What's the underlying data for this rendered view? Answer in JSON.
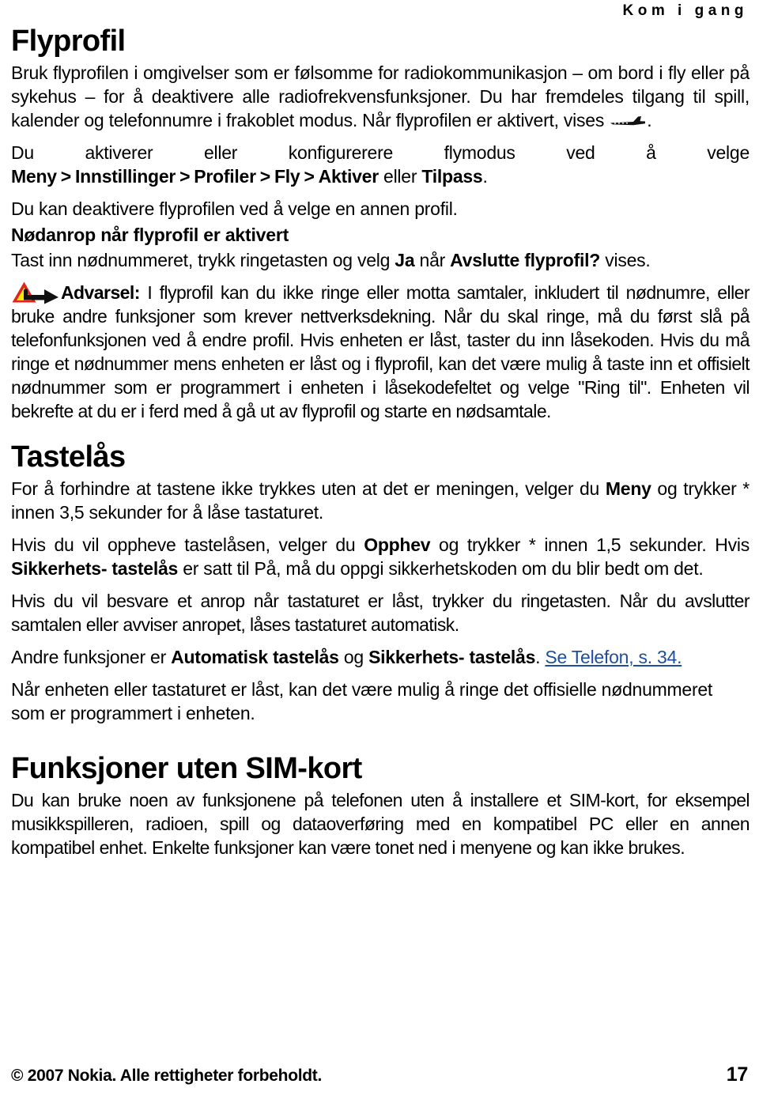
{
  "header": {
    "running_head": "Kom i gang"
  },
  "sections": [
    {
      "id": "flyprofil",
      "title": "Flyprofil",
      "paragraphs": [
        {
          "id": "intro",
          "runs": [
            {
              "t": "Bruk flyprofilen i omgivelser som er følsomme for radiokommunikasjon – om bord i fly eller på sykehus – for å deaktivere alle radiofrekvensfunksjoner. Du har fremdeles tilgang til spill, kalender og telefonnumre i frakoblet modus. Når flyprofilen er aktivert, vises ",
              "style": "normal"
            },
            {
              "t": "airplane-icon",
              "style": "icon"
            },
            {
              "t": ".",
              "style": "normal"
            }
          ]
        },
        {
          "id": "activate",
          "runs": [
            {
              "t": "Du aktiverer eller konfigurerere flymodus ved å velge ",
              "style": "normal"
            },
            {
              "t": "Meny",
              "style": "bold"
            },
            {
              "t": ">",
              "style": "gt"
            },
            {
              "t": "Innstillinger",
              "style": "bold"
            },
            {
              "t": ">",
              "style": "gt"
            },
            {
              "t": "Profiler",
              "style": "bold"
            },
            {
              "t": ">",
              "style": "gt"
            },
            {
              "t": "Fly",
              "style": "bold"
            },
            {
              "t": ">",
              "style": "gt"
            },
            {
              "t": "Aktiver",
              "style": "bold"
            },
            {
              "t": " eller ",
              "style": "normal"
            },
            {
              "t": "Tilpass",
              "style": "bold"
            },
            {
              "t": ".",
              "style": "normal"
            }
          ]
        },
        {
          "id": "deactivate",
          "runs": [
            {
              "t": "Du kan deaktivere flyprofilen ved å velge en annen profil.",
              "style": "normal"
            }
          ]
        }
      ],
      "subsections": [
        {
          "id": "nodanrop",
          "heading": "Nødanrop når flyprofil er aktivert",
          "paragraphs": [
            {
              "id": "nodanrop-p1",
              "runs": [
                {
                  "t": "Tast inn nødnummeret, trykk ringetasten og velg ",
                  "style": "normal"
                },
                {
                  "t": "Ja",
                  "style": "bold"
                },
                {
                  "t": " når ",
                  "style": "normal"
                },
                {
                  "t": "Avslutte flyprofil?",
                  "style": "bold"
                },
                {
                  "t": " vises.",
                  "style": "normal"
                }
              ]
            }
          ]
        }
      ],
      "warning": {
        "icon": "warning-triangle-arrow-icon",
        "label": "Advarsel:",
        "text": " I flyprofil kan du ikke ringe eller motta samtaler, inkludert til nødnumre, eller bruke andre funksjoner som krever nettverksdekning. Når du skal ringe, må du først slå på telefonfunksjonen ved å endre profil. Hvis enheten er låst, taster du inn låsekoden. Hvis du må ringe et nødnummer mens enheten er låst og i flyprofil, kan det være mulig å taste inn et offisielt nødnummer som er programmert i enheten i låsekodefeltet og velge \"Ring til\". Enheten vil bekrefte at du er i ferd med å gå ut av flyprofil og starte en nødsamtale."
      }
    },
    {
      "id": "tastelas",
      "title": "Tastelås",
      "paragraphs": [
        {
          "id": "tastelas-p1",
          "runs": [
            {
              "t": "For å forhindre at tastene ikke trykkes uten at det er meningen, velger du ",
              "style": "normal"
            },
            {
              "t": "Meny",
              "style": "bold"
            },
            {
              "t": " og trykker * innen 3,5 sekunder for å låse tastaturet.",
              "style": "normal"
            }
          ]
        },
        {
          "id": "tastelas-p2",
          "runs": [
            {
              "t": "Hvis du vil oppheve tastelåsen, velger du ",
              "style": "normal"
            },
            {
              "t": "Opphev",
              "style": "bold"
            },
            {
              "t": " og trykker * innen 1,5 sekunder. Hvis ",
              "style": "normal"
            },
            {
              "t": "Sikkerhets- tastelås",
              "style": "bold"
            },
            {
              "t": " er satt til På, må du oppgi sikkerhetskoden om du blir bedt om det.",
              "style": "normal"
            }
          ]
        },
        {
          "id": "tastelas-p3",
          "runs": [
            {
              "t": "Hvis du vil besvare et anrop når tastaturet er låst, trykker du ringetasten. Når du avslutter samtalen eller avviser anropet, låses tastaturet automatisk.",
              "style": "normal"
            }
          ]
        },
        {
          "id": "tastelas-p4",
          "runs": [
            {
              "t": "Andre funksjoner er ",
              "style": "normal"
            },
            {
              "t": "Automatisk tastelås",
              "style": "bold"
            },
            {
              "t": " og ",
              "style": "normal"
            },
            {
              "t": "Sikkerhets- tastelås",
              "style": "bold"
            },
            {
              "t": ". ",
              "style": "normal"
            },
            {
              "t": "Se Telefon, s. 34.",
              "style": "link"
            }
          ]
        },
        {
          "id": "tastelas-p5",
          "runs": [
            {
              "t": "Når enheten eller tastaturet er låst, kan det være mulig å ringe det offisielle nødnummeret som er programmert i enheten.",
              "style": "normal"
            }
          ]
        }
      ]
    },
    {
      "id": "funksjoner-uten-sim",
      "title": "Funksjoner uten SIM-kort",
      "paragraphs": [
        {
          "id": "sim-p1",
          "runs": [
            {
              "t": "Du kan bruke noen av funksjonene på telefonen uten å installere et SIM-kort, for eksempel musikkspilleren, radioen, spill og dataoverføring med en kompatibel PC eller en annen kompatibel enhet. Enkelte funksjoner kan være tonet ned i menyene og kan ikke brukes.",
              "style": "normal"
            }
          ]
        }
      ]
    }
  ],
  "footer": {
    "copyright": "© 2007 Nokia. Alle rettigheter forbeholdt.",
    "page_number": "17"
  },
  "colors": {
    "text": "#000000",
    "link": "#1F4E9C",
    "warning_triangle_red": "#E2231A",
    "warning_triangle_yellow": "#FFE800",
    "warning_arrow": "#111111",
    "background": "#FFFFFF"
  }
}
